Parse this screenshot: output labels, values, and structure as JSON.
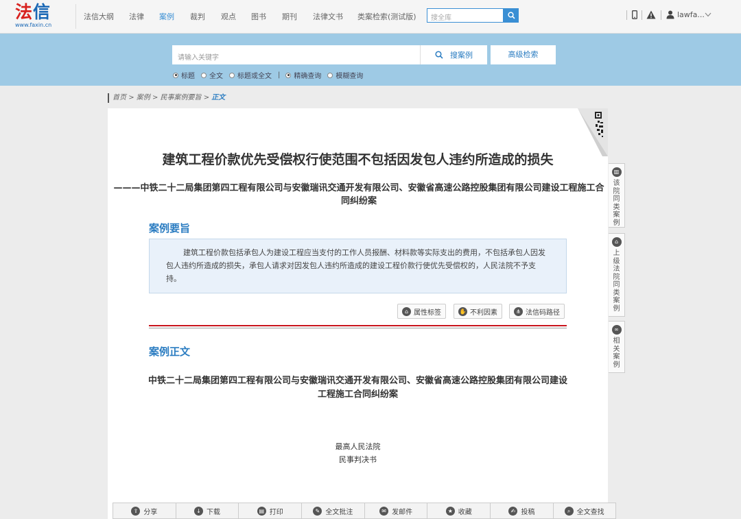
{
  "logo": {
    "main": "法信",
    "sub": "www.faxin.cn"
  },
  "nav": {
    "items": [
      "法信大纲",
      "法律",
      "案例",
      "裁判",
      "观点",
      "图书",
      "期刊",
      "法律文书",
      "类案检索(测试版)"
    ],
    "active": "案例",
    "search_placeholder": "搜全库",
    "user": "lawfa...",
    "icons": [
      "phone-icon",
      "alert-icon",
      "user-icon",
      "chevron-down-icon"
    ]
  },
  "search": {
    "keyword_placeholder": "请输入关键字",
    "search_label": "搜案例",
    "advanced_label": "高级检索",
    "scopes": [
      "标题",
      "全文",
      "标题或全文"
    ],
    "scope_selected": "标题",
    "modes": [
      "精确查询",
      "模糊查询"
    ],
    "mode_selected": "精确查询",
    "divider": "|"
  },
  "breadcrumb": {
    "items": [
      "首页",
      "案例",
      "民事案例要旨"
    ],
    "sep": ">",
    "current": "正文"
  },
  "article": {
    "title": "建筑工程价款优先受偿权行使范围不包括因发包人违约所造成的损失",
    "subtitle": "———中铁二十二局集团第四工程有限公司与安徽瑞讯交通开发有限公司、安徽省高速公路控股集团有限公司建设工程施工合同纠纷案",
    "gist_heading": "案例要旨",
    "gist_text": "建筑工程价款包括承包人为建设工程应当支付的工作人员报酬、材料款等实际支出的费用，不包括承包人因发包人违约所造成的损失，承包人请求对因发包人违约所造成的建设工程价款行使优先受偿权的，人民法院不予支持。",
    "tag_buttons": [
      "属性标签",
      "不利因素",
      "法信码路径"
    ],
    "body_heading": "案例正文",
    "doc_heading": "中铁二十二局集团第四工程有限公司与安徽瑞讯交通开发有限公司、安徽省高速公路控股集团有限公司建设工程施工合同纠纷案",
    "court": "最高人民法院",
    "doc_type": "民事判决书"
  },
  "side_tabs": [
    {
      "label": "该院同类案例",
      "icon": "book-icon"
    },
    {
      "label": "上级法院同类案例",
      "icon": "court-icon"
    },
    {
      "label": "相关案例",
      "icon": "link-icon"
    }
  ],
  "bottom_bar": [
    {
      "label": "分享",
      "icon": "share-icon"
    },
    {
      "label": "下载",
      "icon": "download-icon"
    },
    {
      "label": "打印",
      "icon": "print-icon"
    },
    {
      "label": "全文批注",
      "icon": "note-icon"
    },
    {
      "label": "发邮件",
      "icon": "mail-icon"
    },
    {
      "label": "收藏",
      "icon": "star-icon"
    },
    {
      "label": "投稿",
      "icon": "submit-icon"
    },
    {
      "label": "全文查找",
      "icon": "search-icon"
    }
  ],
  "colors": {
    "brand_red": "#d8221f",
    "brand_blue": "#1a68b5",
    "accent": "#2a7cc1",
    "band": "#9ecae5"
  }
}
